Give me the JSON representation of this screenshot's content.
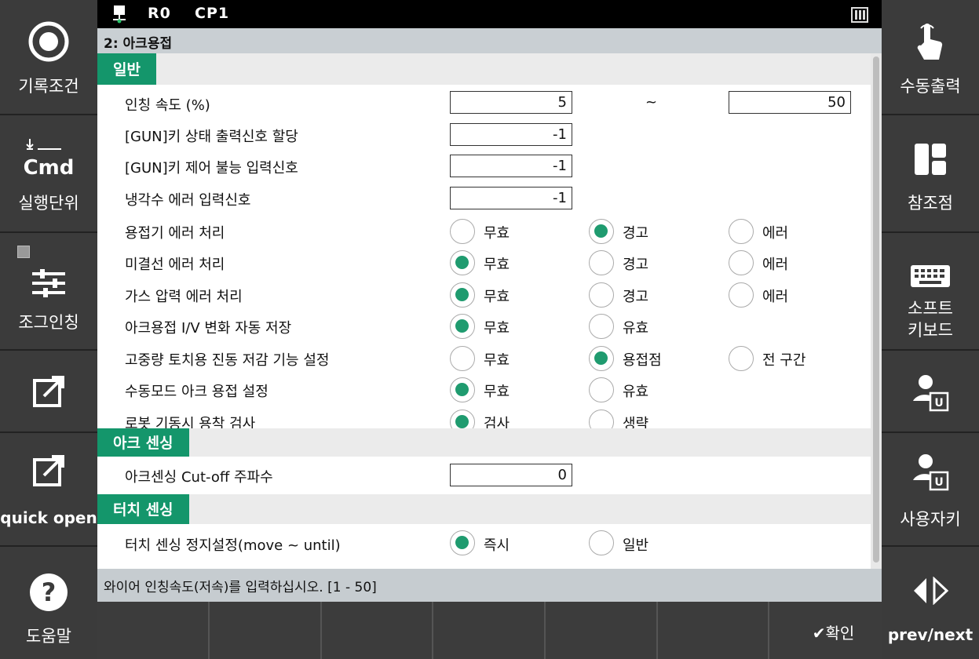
{
  "status": {
    "robot": "R0",
    "program": "CP1"
  },
  "title": "2: 아크용접",
  "left_panel": [
    {
      "label": "기록조건",
      "icon": "record-icon"
    },
    {
      "label": "실행단위",
      "icon": "cmd-icon",
      "icon_text": "Cmd"
    },
    {
      "label": "조그인칭",
      "icon": "sliders-icon"
    },
    {
      "label": "",
      "icon": "open-external-icon"
    },
    {
      "label": "quick open",
      "icon": "open-external-icon"
    },
    {
      "label": "도움말",
      "icon": "help-icon"
    }
  ],
  "right_panel": [
    {
      "label": "수동출력",
      "icon": "touch-hand-icon"
    },
    {
      "label": "참조점",
      "icon": "layout-icon"
    },
    {
      "label": "소프트\n키보드",
      "icon": "keyboard-icon"
    },
    {
      "label": "",
      "icon": "user-key-icon"
    },
    {
      "label": "사용자키",
      "icon": "user-key-icon"
    },
    {
      "label": "prev/next",
      "icon": "prev-next-icon"
    }
  ],
  "sections": {
    "general": {
      "title": "일반"
    },
    "arc_sensing": {
      "title": "아크 센싱"
    },
    "touch_sensing": {
      "title": "터치 센싱"
    }
  },
  "rows": {
    "inching_speed": {
      "label": "인칭 속도 (%)",
      "min": "5",
      "sep": "~",
      "max": "50"
    },
    "gun_key_output": {
      "label": "[GUN]키 상태 출력신호 할당",
      "value": "-1"
    },
    "gun_key_disable": {
      "label": "[GUN]키 제어 불능 입력신호",
      "value": "-1"
    },
    "coolant_error": {
      "label": "냉각수 에러 입력신호",
      "value": "-1"
    },
    "welder_error": {
      "label": "용접기 에러 처리",
      "options": [
        "무효",
        "경고",
        "에러"
      ],
      "selected": 1
    },
    "wire_error": {
      "label": "미결선 에러 처리",
      "options": [
        "무효",
        "경고",
        "에러"
      ],
      "selected": 0
    },
    "gas_error": {
      "label": "가스 압력 에러 처리",
      "options": [
        "무효",
        "경고",
        "에러"
      ],
      "selected": 0
    },
    "iv_auto_save": {
      "label": "아크용접 I/V 변화 자동 저장",
      "options": [
        "무효",
        "유효"
      ],
      "selected": 0
    },
    "vibration": {
      "label": "고중량 토치용 진동 저감 기능 설정",
      "options": [
        "무효",
        "용접점",
        "전 구간"
      ],
      "selected": 1
    },
    "manual_arc": {
      "label": "수동모드 아크 용접 설정",
      "options": [
        "무효",
        "유효"
      ],
      "selected": 0
    },
    "stick_check": {
      "label": "로봇 기동시 용착 검사",
      "options": [
        "검사",
        "생략"
      ],
      "selected": 0
    },
    "arc_cutoff": {
      "label": "아크센싱 Cut-off 주파수",
      "value": "0"
    },
    "touch_stop": {
      "label": "터치 센싱 정지설정(move ~ until)",
      "options": [
        "즉시",
        "일반"
      ],
      "selected": 0
    }
  },
  "message": "와이어 인칭속도(저속)를 입력하십시오. [1 - 50]",
  "fkeys": [
    "",
    "",
    "",
    "",
    "",
    "",
    "✔확인"
  ],
  "colors": {
    "accent": "#14966b",
    "radio_on": "#1f9b6f"
  }
}
